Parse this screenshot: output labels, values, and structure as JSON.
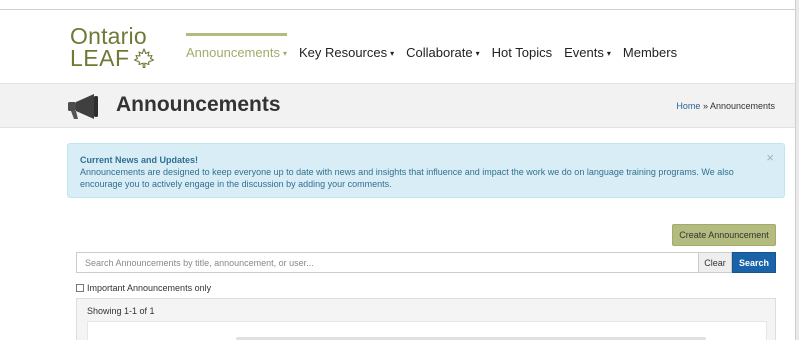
{
  "logo": {
    "line1": "Ontario",
    "line2": "LEAF"
  },
  "nav": {
    "items": [
      {
        "label": "Announcements",
        "caret": "▾"
      },
      {
        "label": "Key Resources",
        "caret": "▾"
      },
      {
        "label": "Collaborate",
        "caret": "▾"
      },
      {
        "label": "Hot Topics",
        "caret": ""
      },
      {
        "label": "Events",
        "caret": "▾"
      },
      {
        "label": "Members",
        "caret": ""
      }
    ],
    "active_color": "#a3ab6c"
  },
  "title_band": {
    "title": "Announcements",
    "breadcrumb_home": "Home",
    "breadcrumb_sep": " » ",
    "breadcrumb_current": "Announcements"
  },
  "alert": {
    "title": "Current News and Updates!",
    "body": "Announcements are designed to keep everyone up to date with news and insights that influence and impact the work we do on language training programs. We also encourage you to actively engage in the discussion by adding your comments.",
    "close": "×"
  },
  "actions": {
    "create_label": "Create Announcement"
  },
  "search": {
    "placeholder": "Search Announcements by title, announcement, or user...",
    "value": "",
    "clear_label": "Clear",
    "search_label": "Search"
  },
  "filters": {
    "important_label": "Important Announcements only",
    "important_checked": false
  },
  "results": {
    "showing": "Showing 1-1 of 1"
  },
  "colors": {
    "brand": "#6f7a37",
    "accent_button": "#b4bb7e",
    "search_button": "#1a63a8",
    "alert_bg": "#d9edf7"
  },
  "icons": {
    "page_icon": "megaphone-icon",
    "logo_icon": "maple-leaf-icon"
  }
}
